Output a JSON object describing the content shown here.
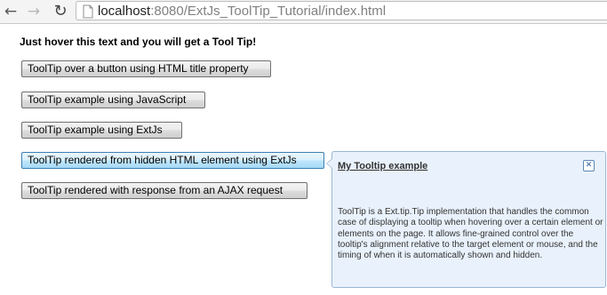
{
  "browser": {
    "back_icon": "arrow-left-icon",
    "forward_icon": "arrow-right-icon",
    "reload_icon": "reload-icon",
    "url_host": "localhost",
    "url_rest": ":8080/ExtJs_ToolTip_Tutorial/index.html"
  },
  "page": {
    "heading": "Just hover this text and you will get a Tool Tip!",
    "buttons": [
      "ToolTip over a button using HTML title property",
      "ToolTip example using JavaScript",
      "ToolTip example using ExtJs",
      "ToolTip rendered from hidden HTML element using ExtJs",
      "ToolTip rendered with response from an AJAX request"
    ]
  },
  "tooltip": {
    "title": "My Tooltip example",
    "close_icon": "close-icon",
    "body": "ToolTip is a Ext.tip.Tip implementation that handles the common case of displaying a tooltip when hovering over a certain element or elements on the page. It allows fine-grained control over the tooltip's alignment relative to the target element or mouse, and the timing of when it is automatically shown and hidden."
  },
  "colors": {
    "tooltip_background": "#e9f2fc",
    "tooltip_border": "#9ab6d6",
    "hovered_button": "#bee6fd"
  }
}
